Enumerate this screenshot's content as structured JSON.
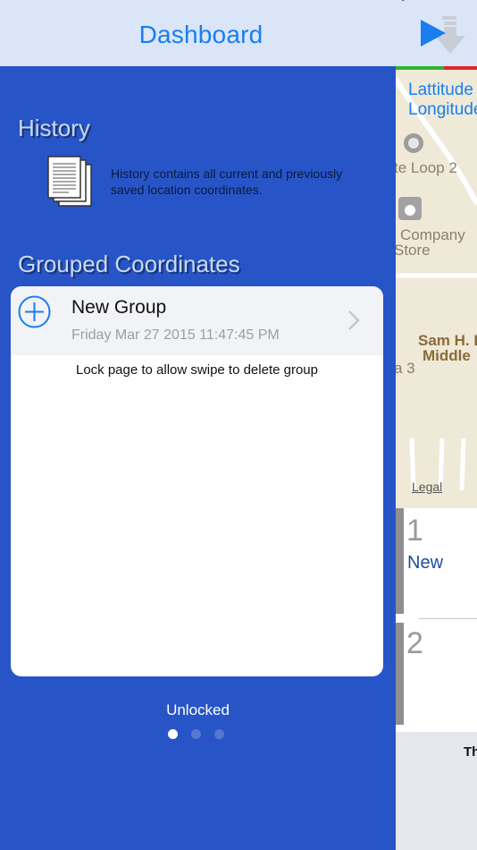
{
  "drawer": {
    "title": "Dashboard",
    "history": {
      "heading": "History",
      "icon": "document-icon",
      "description": "History contains all current and previously saved location coordinates."
    },
    "grouped": {
      "heading": "Grouped Coordinates",
      "items": [
        {
          "name": "New Group",
          "date": "Friday Mar 27 2015 11:47:45 PM"
        }
      ],
      "note": "Lock page to allow swipe to delete group"
    },
    "lock_status": "Unlocked",
    "pages": {
      "count": 3,
      "current": 1
    }
  },
  "main": {
    "coords": {
      "lat_label": "Lattitude",
      "lon_label": "Longitude"
    },
    "map_labels": {
      "loop": "te Loop 2",
      "company_line1": "Company",
      "company_line2": "Store",
      "school_line1": "Sam H. L",
      "school_line2": "Middle",
      "a3": "a 3",
      "legal": "Legal"
    },
    "list": [
      {
        "number": "1",
        "title": "New"
      },
      {
        "number": "2"
      }
    ],
    "bottom_text": "Th"
  },
  "colors": {
    "accent": "#1a7df0",
    "drawer_bg": "#2755c8",
    "header_bg": "#dae6f7"
  }
}
